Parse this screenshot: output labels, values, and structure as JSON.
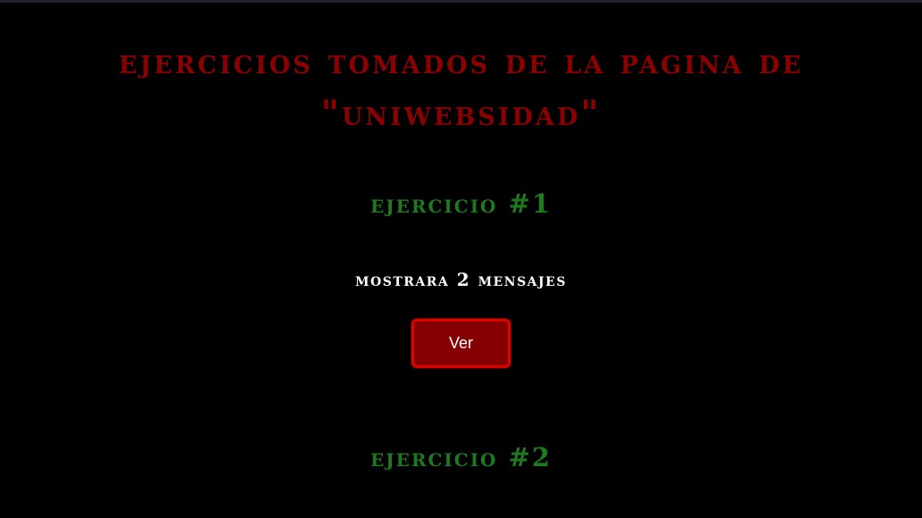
{
  "page": {
    "title_line1": "ejercicios tomados de la pagina de",
    "title_line2": "\"uniwebsidad\""
  },
  "exercises": [
    {
      "heading": "ejercicio #1",
      "description": "mostrara 2 mensajes",
      "button_label": "Ver"
    },
    {
      "heading": "ejercicio #2"
    }
  ],
  "colors": {
    "background": "#000000",
    "title": "#8b0000",
    "exercise_heading": "#1f7a1f",
    "description": "#ffffff",
    "button_fill": "#850000",
    "button_border": "#e00000"
  }
}
